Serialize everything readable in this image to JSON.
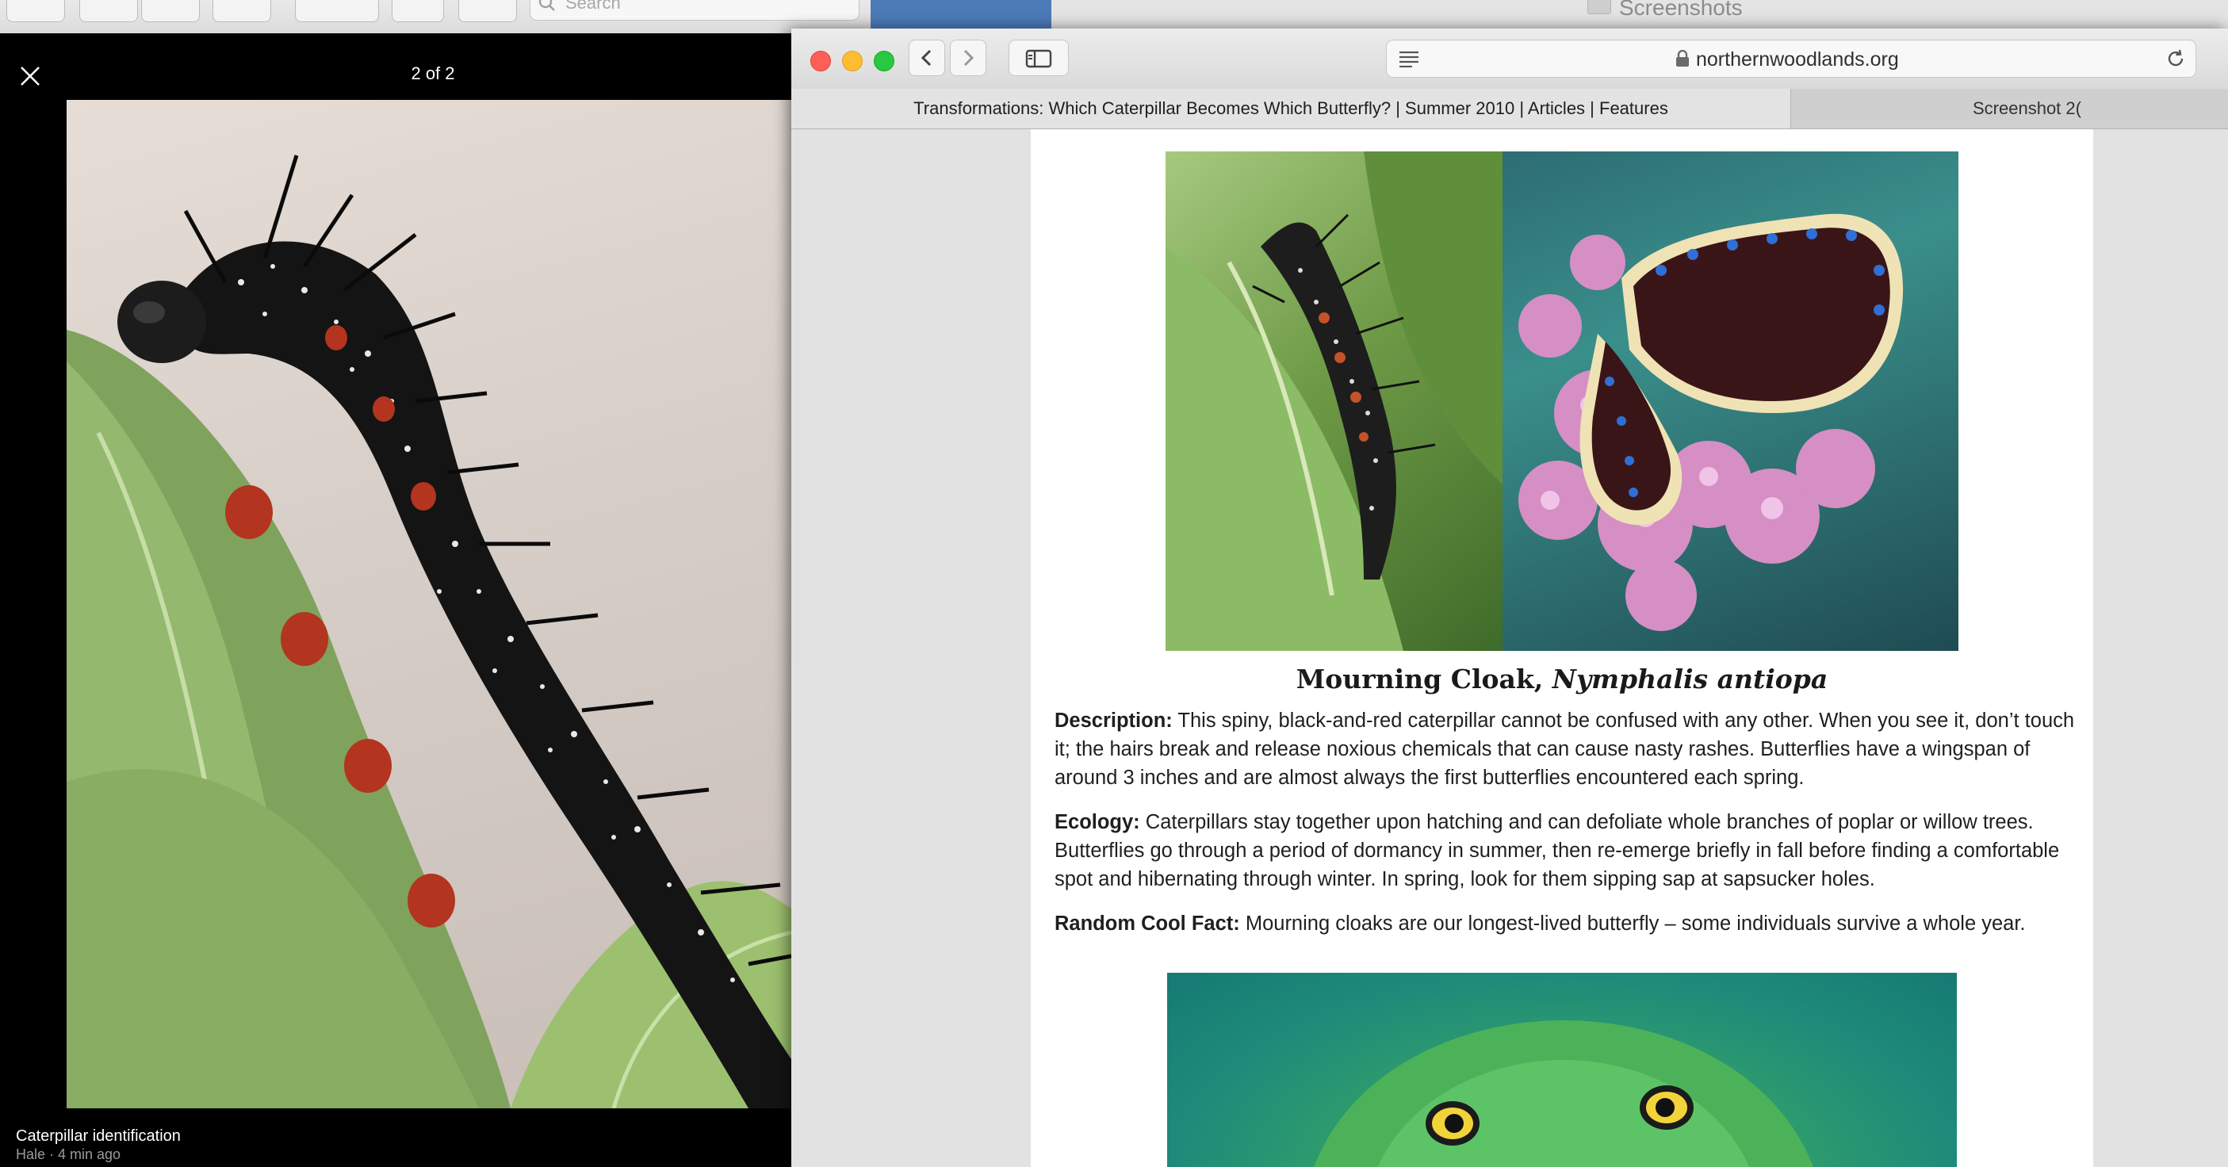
{
  "background": {
    "search_placeholder": "Search",
    "finder_title": "Screenshots"
  },
  "viewer": {
    "counter": "2 of 2",
    "caption_title": "Caterpillar identification",
    "caption_sub": "Hale · 4 min ago"
  },
  "safari": {
    "url": "northernwoodlands.org",
    "tabs": [
      {
        "label": "Transformations: Which Caterpillar Becomes Which Butterfly? | Summer 2010 | Articles | Features"
      },
      {
        "label": "Screenshot 2("
      }
    ]
  },
  "article": {
    "species_common": "Mourning Cloak, ",
    "species_latin": "Nymphalis antiopa",
    "description_label": "Description:",
    "description_text": " This spiny, black-and-red caterpillar cannot be confused with any other. When you see it, don’t touch it; the hairs break and release noxious chemicals that can cause nasty rashes. Butterflies have a wingspan of around 3 inches and are almost always the first butterflies encountered each spring.",
    "ecology_label": "Ecology:",
    "ecology_text": " Caterpillars stay together upon hatching and can defoliate whole branches of poplar or willow trees. Butterflies go through a period of dormancy in summer, then re-emerge briefly in fall before finding a comfortable spot and hibernating through winter. In spring, look for them sipping sap at sapsucker holes.",
    "fact_label": "Random Cool Fact:",
    "fact_text": " Mourning cloaks are our longest-lived butterfly – some individuals survive a whole year."
  },
  "icons": [
    "close-icon",
    "back-icon",
    "forward-icon",
    "sidebar-icon",
    "reader-icon",
    "lock-icon",
    "reload-icon",
    "search-icon"
  ]
}
